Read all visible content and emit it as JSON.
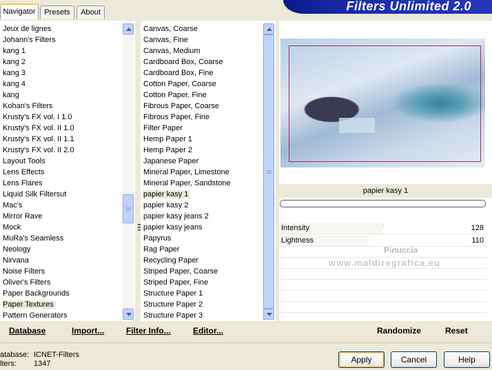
{
  "tabs": [
    {
      "label": "Navigator"
    },
    {
      "label": "Presets"
    },
    {
      "label": "About"
    }
  ],
  "app_title": "Filters Unlimited 2.0",
  "categories": [
    "Jeux de lignes",
    "Johann's Filters",
    "kang 1",
    "kang 2",
    "kang 3",
    "kang 4",
    "kang",
    "Kohan's Filters",
    "Krusty's FX vol. I 1.0",
    "Krusty's FX vol. II 1.0",
    "Krusty's FX vol. II 1.1",
    "Krusty's FX vol. II 2.0",
    "Layout Tools",
    "Lens Effects",
    "Lens Flares",
    "Liquid Silk Filtersut",
    "Mac's",
    "Mirror Rave",
    "Mock",
    "MuRa's Seamless",
    "Neology",
    "Nirvana",
    "Noise Filters",
    "Oliver's Filters",
    "Paper Backgrounds",
    "Paper Textures",
    "Pattern Generators"
  ],
  "selected_category": "Paper Textures",
  "filters": [
    "Canvas, Coarse",
    "Canvas, Fine",
    "Canvas, Medium",
    "Cardboard Box, Coarse",
    "Cardboard Box, Fine",
    "Cotton Paper, Coarse",
    "Cotton Paper, Fine",
    "Fibrous Paper, Coarse",
    "Fibrous Paper, Fine",
    "Filter Paper",
    "Hemp Paper 1",
    "Hemp Paper 2",
    "Japanese Paper",
    "Mineral Paper, Limestone",
    "Mineral Paper, Sandstone",
    "papier kasy 1",
    "papier kasy 2",
    "papier kasy jeans 2",
    "papier kasy jeans",
    "Papyrus",
    "Rag Paper",
    "Recycling Paper",
    "Striped Paper, Coarse",
    "Striped Paper, Fine",
    "Structure Paper 1",
    "Structure Paper 2",
    "Structure Paper 3"
  ],
  "selected_filter": "papier kasy 1",
  "links": {
    "database": "Database",
    "import": "Import...",
    "filter_info": "Filter Info...",
    "editor": "Editor...",
    "randomize": "Randomize",
    "reset": "Reset"
  },
  "preview": {
    "filter_name": "papier kasy 1"
  },
  "params": [
    {
      "label": "Intensity",
      "value": "128"
    },
    {
      "label": "Lightness",
      "value": "110"
    }
  ],
  "watermark": {
    "line1": "Pinuccia",
    "line2": "www.maldiregrafica.eu"
  },
  "footer": {
    "database_label": "atabase:",
    "database_value": "ICNET-Filters",
    "filters_label": "lters:",
    "filters_value": "1347"
  },
  "buttons": {
    "apply": "Apply",
    "cancel": "Cancel",
    "help": "Help"
  }
}
